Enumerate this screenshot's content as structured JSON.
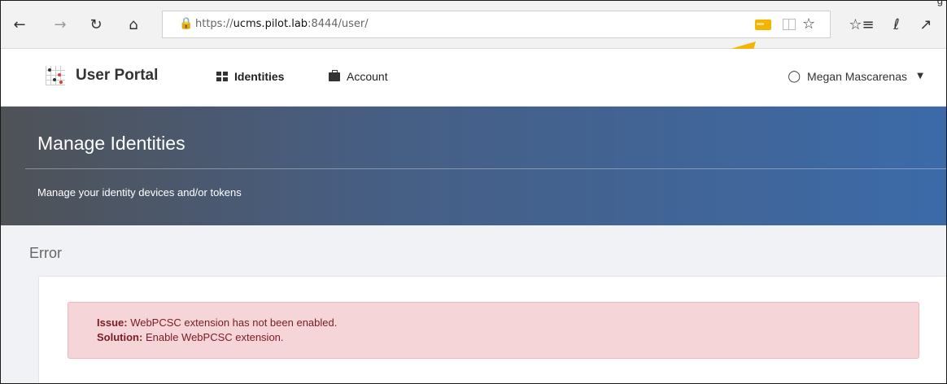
{
  "browser": {
    "url_prefix": "https://",
    "url_host": "ucms.pilot.lab",
    "url_rest": ":8444/user/",
    "corner_text": "g"
  },
  "app": {
    "brand": "User Portal",
    "nav": [
      {
        "label": "Identities",
        "active": true
      },
      {
        "label": "Account",
        "active": false
      }
    ],
    "user_name": "Megan Mascarenas"
  },
  "banner": {
    "title": "Manage Identities",
    "subtitle": "Manage your identity devices and/or tokens"
  },
  "content": {
    "section_title": "Error",
    "alert": {
      "issue_label": "Issue:",
      "issue_text": " WebPCSC extension has not been enabled.",
      "solution_label": "Solution:",
      "solution_text": " Enable WebPCSC extension."
    }
  },
  "colors": {
    "annotation_arrow": "#f5b400",
    "banner_start": "#4f5257",
    "banner_end": "#3c6aa8",
    "alert_bg": "#f5d5d8",
    "alert_text": "#7a1c26"
  },
  "icons": [
    "back-icon",
    "forward-icon",
    "refresh-icon",
    "home-icon",
    "lock-icon",
    "smartcard-extension-icon",
    "reading-view-icon",
    "favorite-star-icon",
    "favorites-list-icon",
    "pen-icon",
    "share-icon",
    "identities-grid-icon",
    "briefcase-icon",
    "user-icon",
    "caret-down-icon"
  ]
}
